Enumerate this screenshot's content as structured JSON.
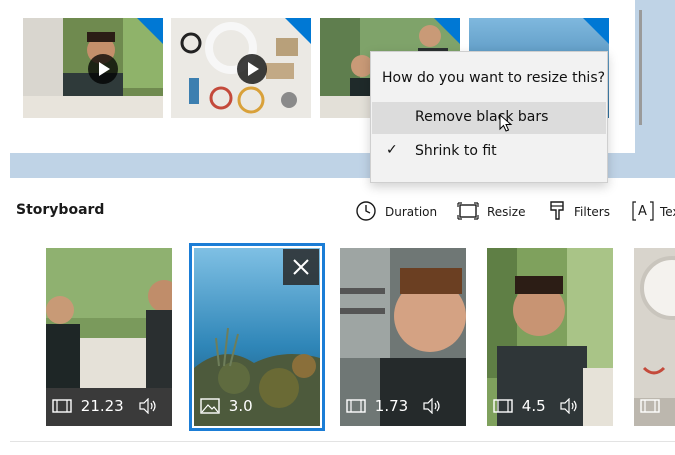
{
  "library": {
    "thumbnails": [
      {
        "name": "classroom-video",
        "has_play": true
      },
      {
        "name": "supplies-video",
        "has_play": true
      },
      {
        "name": "boy-portrait-video",
        "has_play": false
      },
      {
        "name": "underwater-photo",
        "has_play": false
      }
    ]
  },
  "resize_menu": {
    "title": "How do you want to resize this?",
    "items": [
      {
        "label": "Remove black bars",
        "checked": false,
        "hover": true
      },
      {
        "label": "Shrink to fit",
        "checked": true,
        "hover": false
      }
    ]
  },
  "storyboard": {
    "title": "Storyboard",
    "tools": [
      {
        "label": "Duration",
        "icon": "clock-icon"
      },
      {
        "label": "Resize",
        "icon": "resize-icon"
      },
      {
        "label": "Filters",
        "icon": "filters-icon"
      },
      {
        "label": "Tex",
        "icon": "text-icon"
      }
    ],
    "cards": [
      {
        "duration": "21.23",
        "type": "video",
        "has_audio": true,
        "selected": false
      },
      {
        "duration": "3.0",
        "type": "image",
        "has_audio": false,
        "selected": true
      },
      {
        "duration": "1.73",
        "type": "video",
        "has_audio": true,
        "selected": false
      },
      {
        "duration": "4.5",
        "type": "video",
        "has_audio": true,
        "selected": false
      }
    ]
  },
  "colors": {
    "accent": "#0078d4",
    "selection": "#1b7dd6",
    "menu_bg": "#f2f2f2",
    "menu_hover": "#dcdcdc",
    "library_bg": "#bfd3e6"
  }
}
